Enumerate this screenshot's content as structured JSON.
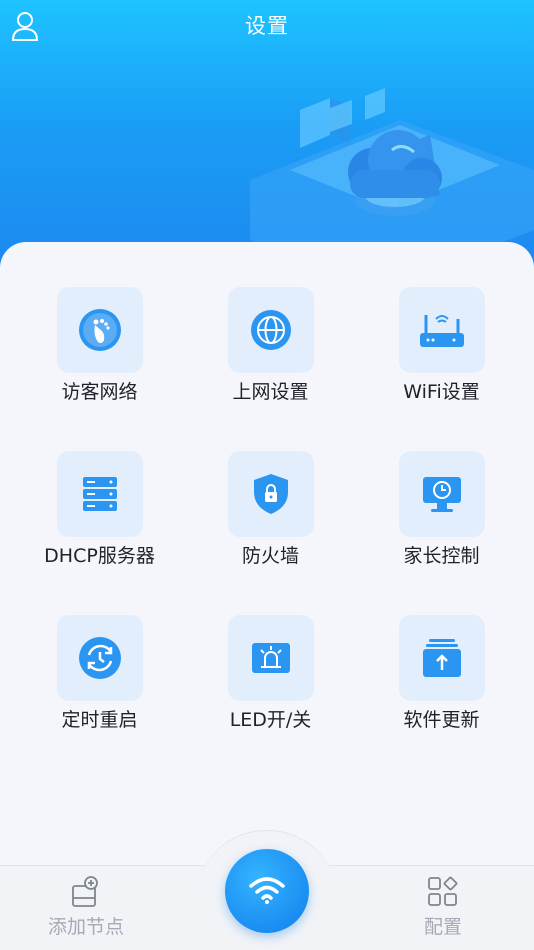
{
  "header": {
    "title": "设置"
  },
  "tiles": [
    {
      "label": "访客网络",
      "icon": "footprint-icon"
    },
    {
      "label": "上网设置",
      "icon": "globe-icon"
    },
    {
      "label": "WiFi设置",
      "icon": "router-icon"
    },
    {
      "label": "DHCP服务器",
      "icon": "server-icon"
    },
    {
      "label": "防火墙",
      "icon": "shield-lock-icon"
    },
    {
      "label": "家长控制",
      "icon": "monitor-clock-icon"
    },
    {
      "label": "定时重启",
      "icon": "clock-refresh-icon"
    },
    {
      "label": "LED开/关",
      "icon": "led-icon"
    },
    {
      "label": "软件更新",
      "icon": "upload-icon"
    }
  ],
  "bottom_nav": {
    "add_node": "添加节点",
    "config": "配置"
  },
  "colors": {
    "header_gradient_top": "#1ec3ff",
    "header_gradient_bottom": "#1e86f0",
    "tile_bg": "#e3eefc",
    "icon_blue": "#1a8ef2",
    "nav_text": "#a4abb6"
  }
}
